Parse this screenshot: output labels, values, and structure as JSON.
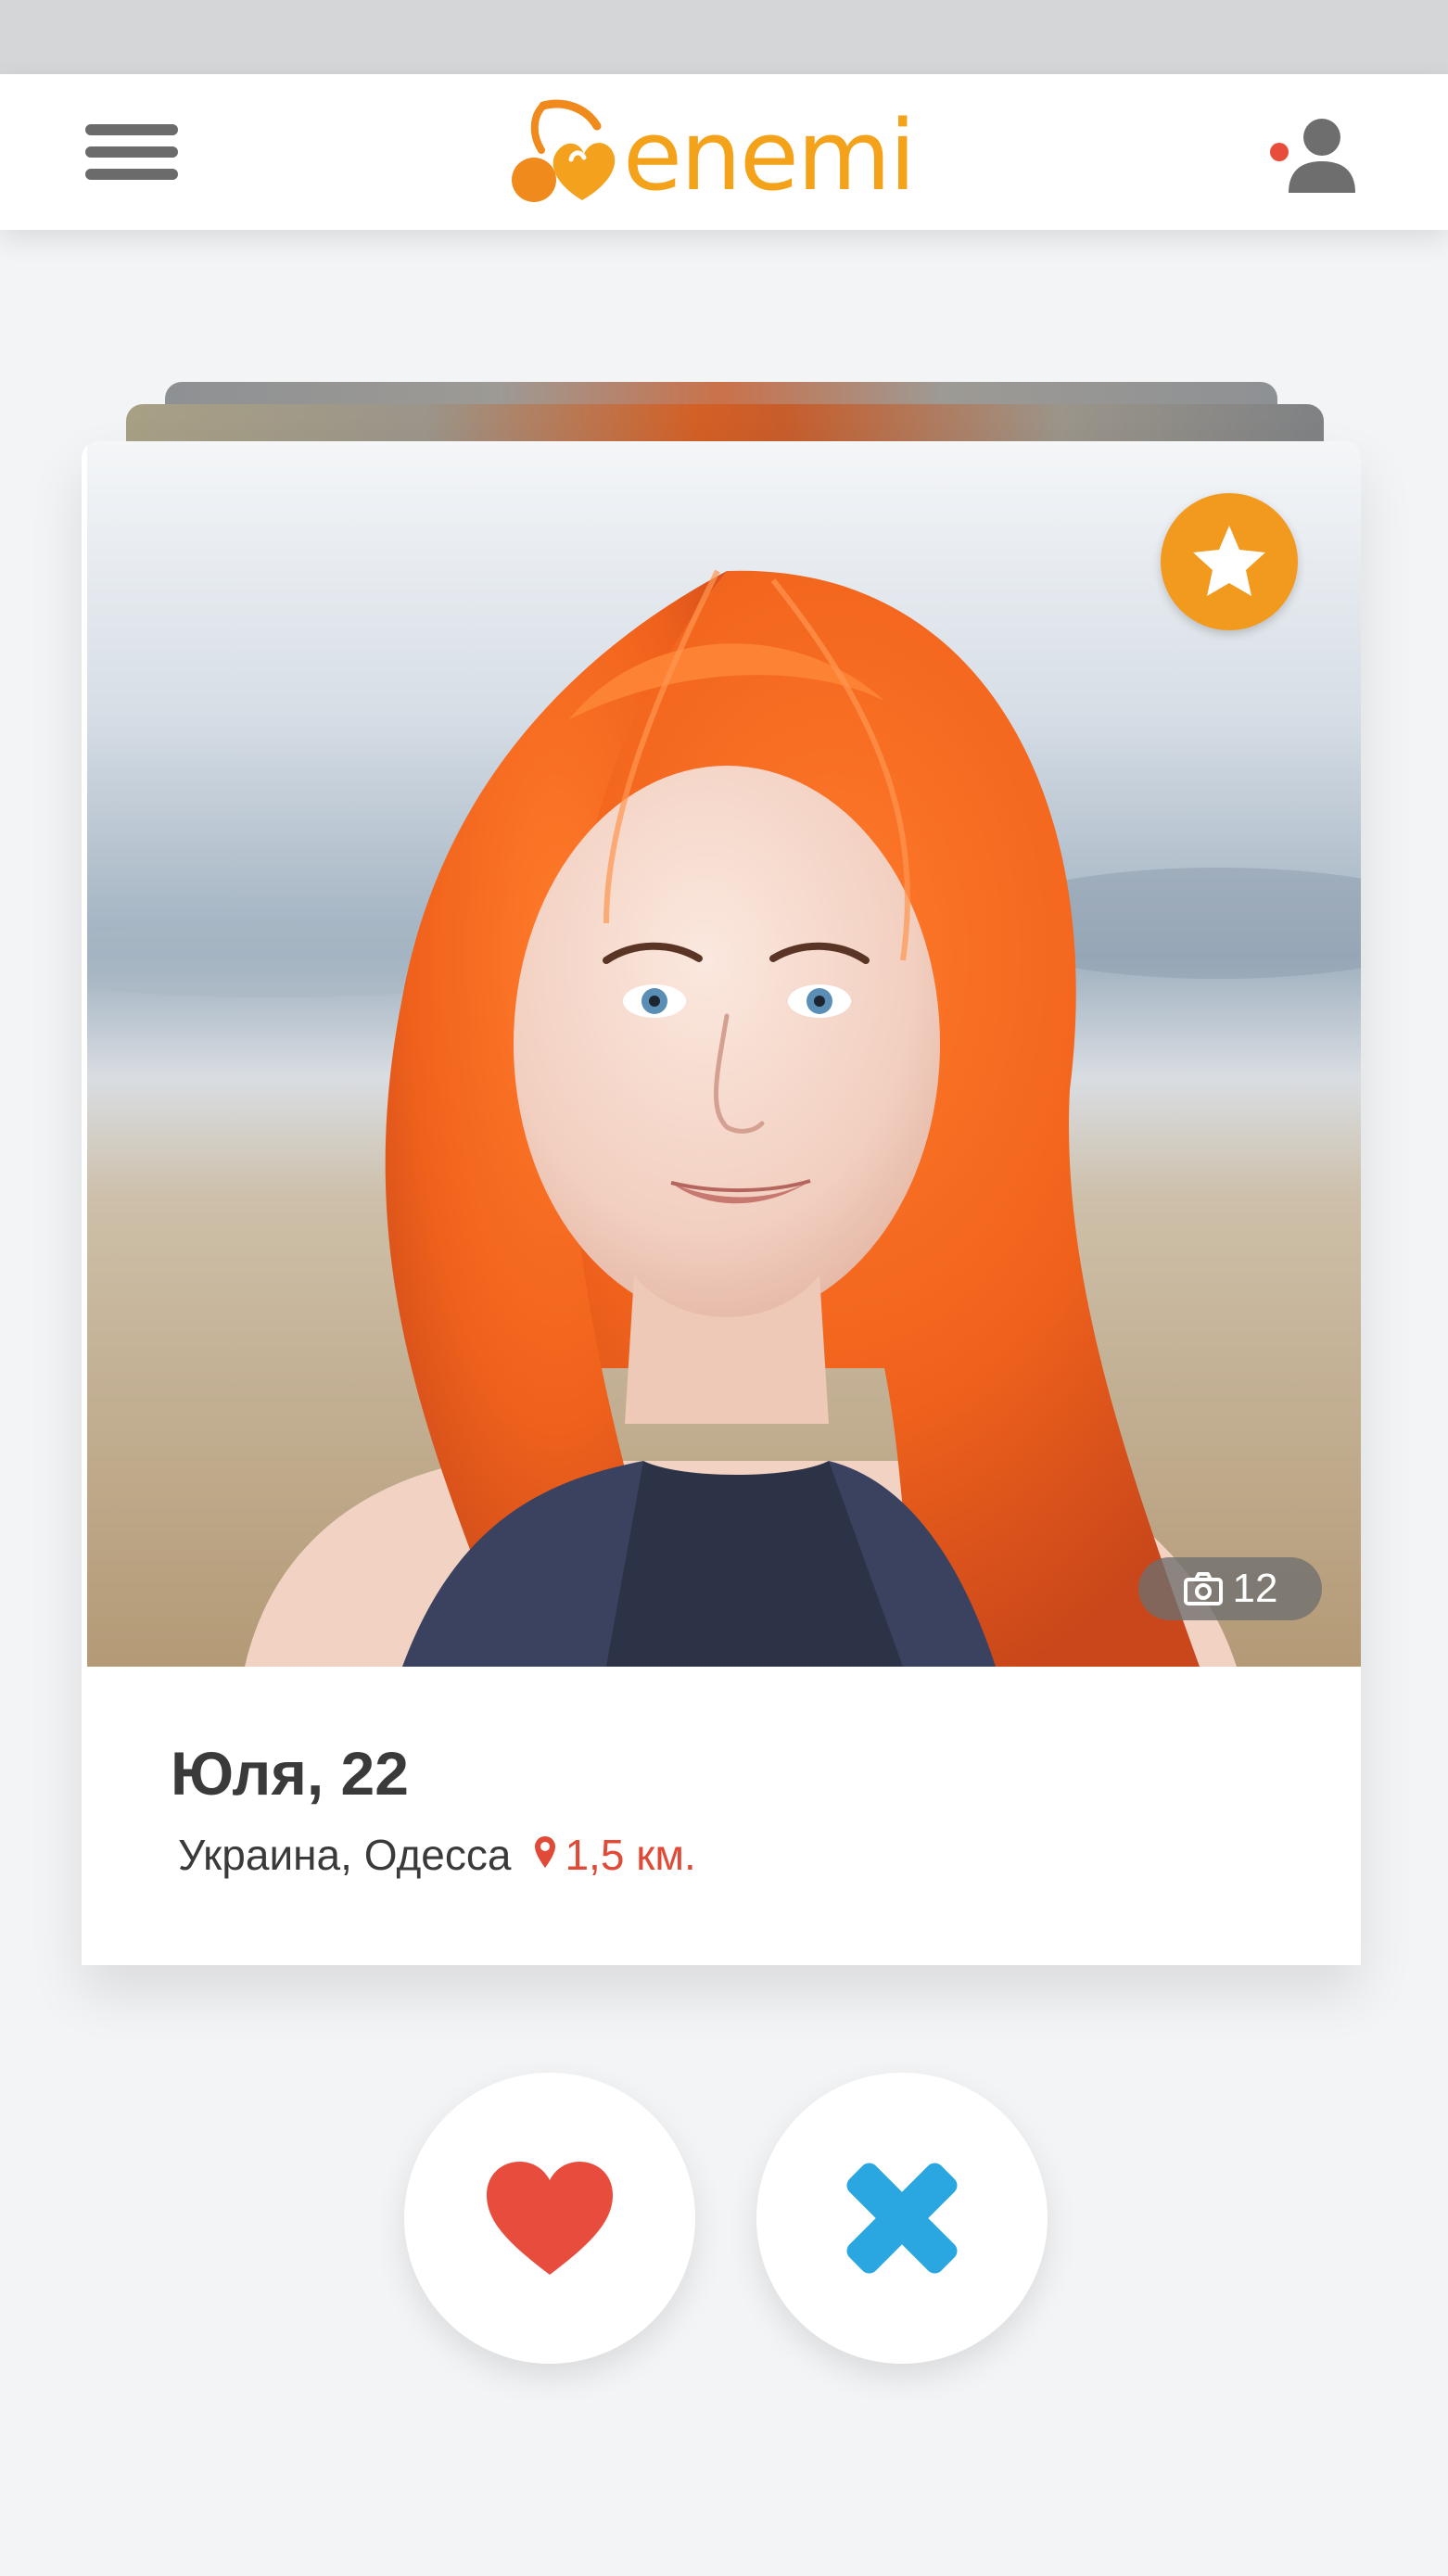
{
  "app": {
    "logo_text": "enemi",
    "logo_color": "#f3a21a",
    "accent_orange": "#f19a1e",
    "accent_red": "#e74c3c",
    "accent_blue": "#2aa7e0"
  },
  "header": {
    "menu_icon": "hamburger-menu-icon",
    "profile_icon": "user-profile-icon",
    "has_notification": true
  },
  "profile": {
    "name_age": "Юля, 22",
    "location": "Украина, Одесса",
    "distance": "1,5 км.",
    "photo_count": "12",
    "favorite_icon": "star-icon",
    "camera_icon": "camera-icon",
    "pin_icon": "location-pin-icon"
  },
  "actions": {
    "like_icon": "heart-icon",
    "dislike_icon": "cross-icon"
  }
}
